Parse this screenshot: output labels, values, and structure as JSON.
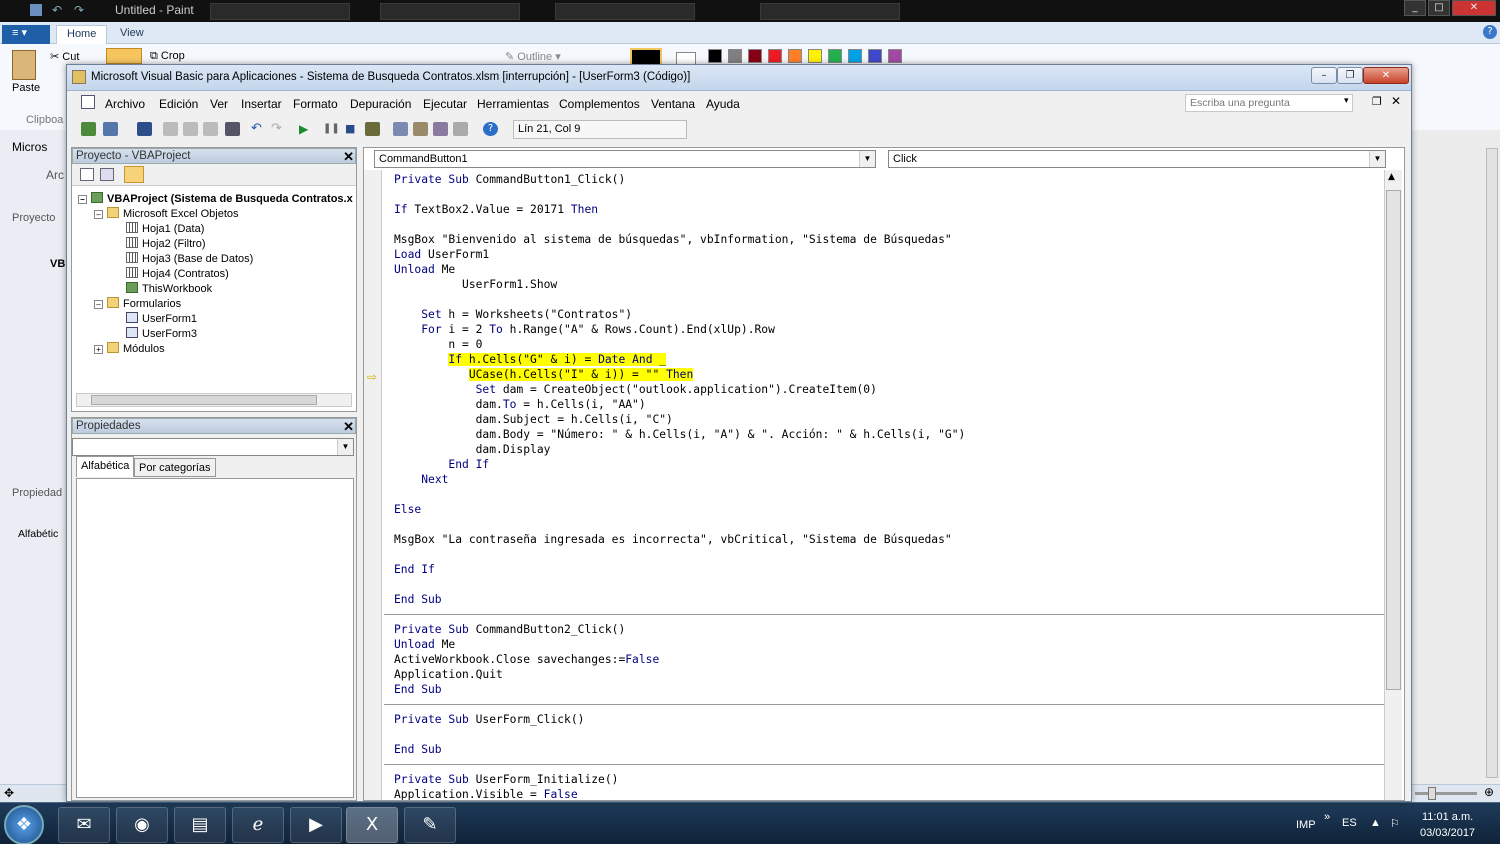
{
  "paint": {
    "title": "Untitled - Paint",
    "tabs": [
      "Home",
      "View"
    ],
    "ribbon": {
      "cut": "Cut",
      "crop": "Crop",
      "paste": "Paste",
      "clipboard": "Clipboa",
      "outline": "Outline"
    },
    "bg_window": {
      "title_frag": "Micros",
      "arch": "Arc",
      "proyecto": "Proyecto",
      "vb": "VB",
      "propiedad": "Propiedad",
      "alfabetica": "Alfabétic"
    },
    "palette": [
      "#000000",
      "#7f7f7f",
      "#880015",
      "#ed1c24",
      "#ff7f27",
      "#fff200",
      "#22b14c",
      "#00a2e8",
      "#3f48cc",
      "#a349a4"
    ]
  },
  "vbe": {
    "title": "Microsoft Visual Basic para Aplicaciones - Sistema de Busqueda Contratos.xlsm [interrupción] - [UserForm3 (Código)]",
    "menu": [
      "Archivo",
      "Edición",
      "Ver",
      "Insertar",
      "Formato",
      "Depuración",
      "Ejecutar",
      "Herramientas",
      "Complementos",
      "Ventana",
      "Ayuda"
    ],
    "ask_placeholder": "Escriba una pregunta",
    "position": "Lín 21, Col 9",
    "project": {
      "header": "Proyecto - VBAProject",
      "root": "VBAProject (Sistema de Busqueda Contratos.x",
      "excel_objects": "Microsoft Excel Objetos",
      "sheets": [
        "Hoja1 (Data)",
        "Hoja2 (Filtro)",
        "Hoja3 (Base de Datos)",
        "Hoja4 (Contratos)",
        "ThisWorkbook"
      ],
      "forms_folder": "Formularios",
      "forms": [
        "UserForm1",
        "UserForm3"
      ],
      "modules": "Módulos"
    },
    "properties": {
      "header": "Propiedades",
      "tab_alpha": "Alfabética",
      "tab_cat": "Por categorías"
    },
    "object_combo": "CommandButton1",
    "proc_combo": "Click",
    "code_lines": [
      "Private Sub CommandButton1_Click()",
      "",
      "If TextBox2.Value = 20171 Then",
      "",
      "MsgBox \"Bienvenido al sistema de búsquedas\", vbInformation, \"Sistema de Búsquedas\"",
      "Load UserForm1",
      "Unload Me",
      "          UserForm1.Show",
      "",
      "    Set h = Worksheets(\"Contratos\")",
      "    For i = 2 To h.Range(\"A\" & Rows.Count).End(xlUp).Row",
      "        n = 0",
      "        If h.Cells(\"G\" & i) = Date And _",
      "           UCase(h.Cells(\"I\" & i)) = \"\" Then",
      "            Set dam = CreateObject(\"outlook.application\").CreateItem(0)",
      "            dam.To = h.Cells(i, \"AA\")",
      "            dam.Subject = h.Cells(i, \"C\")",
      "            dam.Body = \"Número: \" & h.Cells(i, \"A\") & \". Acción: \" & h.Cells(i, \"G\")",
      "            dam.Display",
      "        End If",
      "    Next",
      "",
      "Else",
      "",
      "MsgBox \"La contraseña ingresada es incorrecta\", vbCritical, \"Sistema de Búsquedas\"",
      "",
      "End If",
      "",
      "End Sub",
      "",
      "Private Sub CommandButton2_Click()",
      "Unload Me",
      "ActiveWorkbook.Close savechanges:=False",
      "Application.Quit",
      "End Sub",
      "",
      "Private Sub UserForm_Click()",
      "",
      "End Sub",
      "",
      "Private Sub UserForm_Initialize()",
      "Application.Visible = False"
    ]
  },
  "taskbar": {
    "lang_imp": "IMP",
    "lang_es": "ES",
    "time": "11:01 a.m.",
    "date": "03/03/2017"
  },
  "colors": {
    "highlight": "#ffff00",
    "keyword": "#00007f"
  }
}
